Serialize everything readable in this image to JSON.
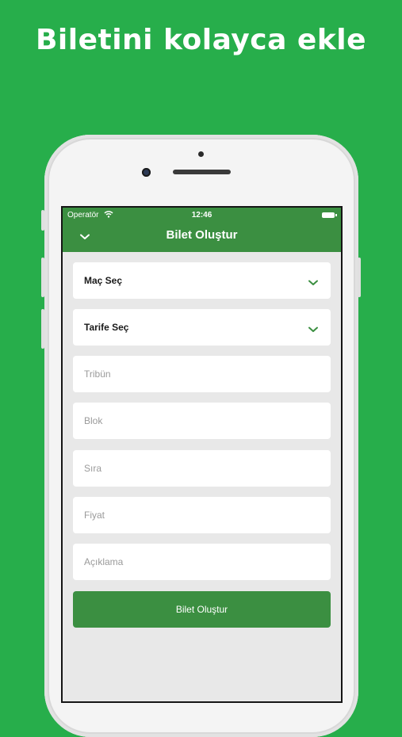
{
  "headline": "Biletini kolayca ekle",
  "colors": {
    "background": "#27ae4b",
    "app_bar": "#3b8f41",
    "screen_bg": "#e8e8e8"
  },
  "status_bar": {
    "carrier": "Operatör",
    "time": "12:46",
    "icons": [
      "wifi-icon",
      "battery-icon"
    ]
  },
  "nav": {
    "title": "Bilet Oluştur",
    "back_icon": "chevron-down-icon"
  },
  "form": {
    "selects": [
      {
        "label": "Maç Seç",
        "icon": "chevron-down-icon"
      },
      {
        "label": "Tarife Seç",
        "icon": "chevron-down-icon"
      }
    ],
    "inputs": [
      {
        "placeholder": "Tribün"
      },
      {
        "placeholder": "Blok"
      },
      {
        "placeholder": "Sıra"
      },
      {
        "placeholder": "Fiyat"
      },
      {
        "placeholder": "Açıklama"
      }
    ],
    "submit_label": "Bilet Oluştur"
  }
}
